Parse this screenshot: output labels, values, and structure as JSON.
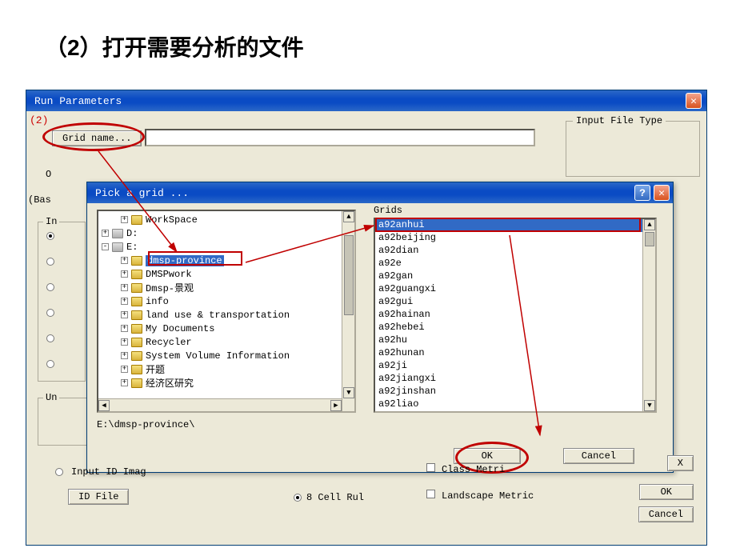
{
  "slide": {
    "heading": "（2）打开需要分析的文件"
  },
  "outer": {
    "title": "Run Parameters",
    "red_marker": "(2)",
    "grid_name_btn": "Grid name...",
    "input_file_type": "Input File Type",
    "frag_O": "O",
    "frag_bas": "(Bas",
    "in_group": "In",
    "un_group": "Un",
    "x_btn": "X",
    "input_id": "Input ID Imag",
    "id_file_btn": "ID File",
    "eight_cell": "8 Cell Rul",
    "class_metric": "Class Metri",
    "landscape_metric": "Landscape Metric",
    "ok": "OK",
    "cancel": "Cancel"
  },
  "dlg": {
    "title": "Pick a grid ...",
    "path": "E:\\dmsp-province\\",
    "ok": "OK",
    "cancel": "Cancel",
    "grids_label": "Grids",
    "tree": [
      {
        "indent": 1,
        "toggle": "+",
        "icon": "folder",
        "label": "WorkSpace"
      },
      {
        "indent": 0,
        "toggle": "+",
        "icon": "drive",
        "label": "D:"
      },
      {
        "indent": 0,
        "toggle": "-",
        "icon": "drive",
        "label": "E:"
      },
      {
        "indent": 1,
        "toggle": "+",
        "icon": "folder",
        "label": "dmsp-province",
        "selected": true
      },
      {
        "indent": 1,
        "toggle": "+",
        "icon": "folder",
        "label": "DMSPwork"
      },
      {
        "indent": 1,
        "toggle": "+",
        "icon": "folder",
        "label": "Dmsp-景观"
      },
      {
        "indent": 1,
        "toggle": "+",
        "icon": "folder",
        "label": "info"
      },
      {
        "indent": 1,
        "toggle": "+",
        "icon": "folder",
        "label": "land use & transportation"
      },
      {
        "indent": 1,
        "toggle": "+",
        "icon": "folder",
        "label": "My Documents"
      },
      {
        "indent": 1,
        "toggle": "+",
        "icon": "folder",
        "label": "Recycler"
      },
      {
        "indent": 1,
        "toggle": "+",
        "icon": "folder",
        "label": "System Volume Information"
      },
      {
        "indent": 1,
        "toggle": "+",
        "icon": "folder",
        "label": "开题"
      },
      {
        "indent": 1,
        "toggle": "+",
        "icon": "folder",
        "label": "经济区研究"
      }
    ],
    "grids": [
      {
        "label": "a92anhui",
        "selected": true
      },
      {
        "label": "a92beijing"
      },
      {
        "label": "a92dian"
      },
      {
        "label": "a92e"
      },
      {
        "label": "a92gan"
      },
      {
        "label": "a92guangxi"
      },
      {
        "label": "a92gui"
      },
      {
        "label": "a92hainan"
      },
      {
        "label": "a92hebei"
      },
      {
        "label": "a92hu"
      },
      {
        "label": "a92hunan"
      },
      {
        "label": "a92ji"
      },
      {
        "label": "a92jiangxi"
      },
      {
        "label": "a92jinshan"
      },
      {
        "label": "a92liao"
      }
    ]
  }
}
